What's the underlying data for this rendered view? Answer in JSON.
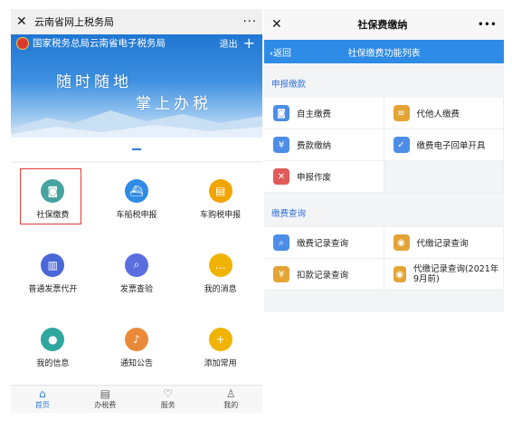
{
  "left": {
    "window_title": "云南省网上税务局",
    "header": {
      "agency": "国家税务总局云南省电子税务局",
      "exit_label": "退出"
    },
    "slogan": {
      "line1": "随时随地",
      "line2": "掌上办税"
    },
    "grid": [
      {
        "label": "社保缴费",
        "icon": "camera-icon",
        "color": "#45a3a0",
        "selected": true
      },
      {
        "label": "车船税申报",
        "icon": "ship-icon",
        "color": "#2e8be6"
      },
      {
        "label": "车购税申报",
        "icon": "car-icon",
        "color": "#f0a500"
      },
      {
        "label": "普通发票代开",
        "icon": "invoice-icon",
        "color": "#4a67d8"
      },
      {
        "label": "发票查验",
        "icon": "search-icon",
        "color": "#5b6ee0"
      },
      {
        "label": "我的消息",
        "icon": "message-icon",
        "color": "#f0b400"
      },
      {
        "label": "我的信息",
        "icon": "user-icon",
        "color": "#2fa7a0"
      },
      {
        "label": "通知公告",
        "icon": "bell-icon",
        "color": "#e98a3b"
      },
      {
        "label": "添加常用",
        "icon": "plus-icon",
        "color": "#f0b400"
      }
    ],
    "tabs": [
      {
        "label": "首页",
        "icon": "home-icon",
        "active": true
      },
      {
        "label": "办税费",
        "icon": "doc-icon"
      },
      {
        "label": "服务",
        "icon": "heart-icon"
      },
      {
        "label": "我的",
        "icon": "person-icon"
      }
    ]
  },
  "right": {
    "window_title": "社保费缴纳",
    "nav": {
      "back_label": "返回",
      "title": "社保缴费功能列表"
    },
    "sections": [
      {
        "title": "申报缴款",
        "items": [
          {
            "label": "自主缴费",
            "icon": "self-pay-icon",
            "color": "#4c8de6"
          },
          {
            "label": "代他人缴费",
            "icon": "proxy-pay-icon",
            "color": "#e3a435"
          },
          {
            "label": "费款缴纳",
            "icon": "fee-pay-icon",
            "color": "#4c8de6"
          },
          {
            "label": "缴费电子回单开具",
            "icon": "receipt-icon",
            "color": "#4c8de6"
          },
          {
            "label": "申报作废",
            "icon": "void-icon",
            "color": "#e05a5a"
          }
        ]
      },
      {
        "title": "缴费查询",
        "items": [
          {
            "label": "缴费记录查询",
            "icon": "record-search-icon",
            "color": "#4c8de6"
          },
          {
            "label": "代缴记录查询",
            "icon": "proxy-record-icon",
            "color": "#e3a435"
          },
          {
            "label": "扣款记录查询",
            "icon": "deduct-record-icon",
            "color": "#e3a435"
          },
          {
            "label": "代缴记录查询(2021年9月前)",
            "icon": "proxy-history-icon",
            "color": "#e3a435"
          }
        ]
      }
    ]
  }
}
